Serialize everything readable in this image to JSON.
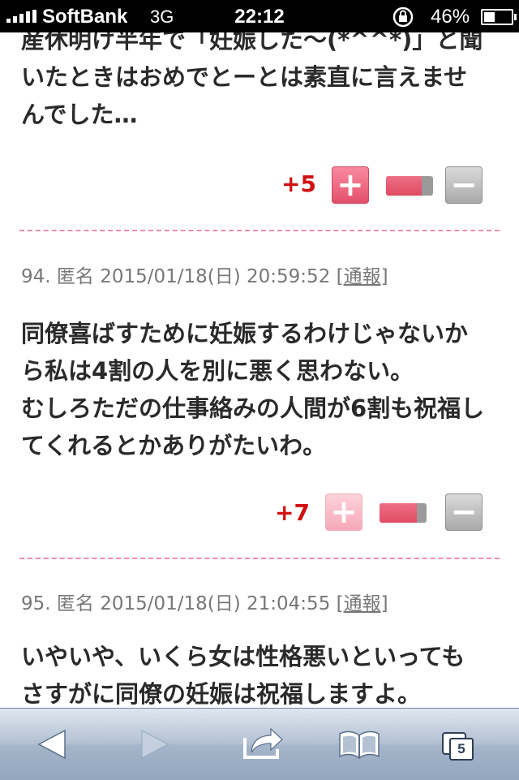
{
  "status_bar": {
    "carrier": "SoftBank",
    "network": "3G",
    "time": "22:12",
    "battery": "46%",
    "battery_level": 0.46
  },
  "posts": [
    {
      "text_lines": [
        "産休明け半年で「妊娠した〜(*^^*)」と聞",
        "いたときはおめでとーとは素直に言えませ",
        "んでした…"
      ],
      "score": "+5",
      "ratio": 0.75
    },
    {
      "number": "94.",
      "author": "匿名",
      "date": "2015/01/18(日) 20:59:52",
      "report_label": "[通報]",
      "text_lines": [
        "同僚喜ばすために妊娠するわけじゃないか",
        "ら私は4割の人を別に悪く思わない。",
        "むしろただの仕事絡みの人間が6割も祝福し",
        "てくれるとかありがたいわ。"
      ],
      "score": "+7",
      "ratio": 0.8
    },
    {
      "number": "95.",
      "author": "匿名",
      "date": "2015/01/18(日) 21:04:55",
      "report_label": "[通報]",
      "text_lines": [
        "いやいや、いくら女は性格悪いといっても",
        "さすがに同僚の妊娠は祝福しますよ。"
      ]
    }
  ],
  "vote_symbols": {
    "plus": "+",
    "minus": "−"
  },
  "toolbar": {
    "tab_count": "5",
    "icons": [
      "back-icon",
      "forward-icon",
      "share-icon",
      "bookmarks-icon",
      "tabs-icon"
    ]
  },
  "colors": {
    "score": "#d01010",
    "divider": "#ef8ea4",
    "plus_button": "#e3506a",
    "minus_button": "#a9a9a9",
    "toolbar": "#b3c1d3"
  }
}
